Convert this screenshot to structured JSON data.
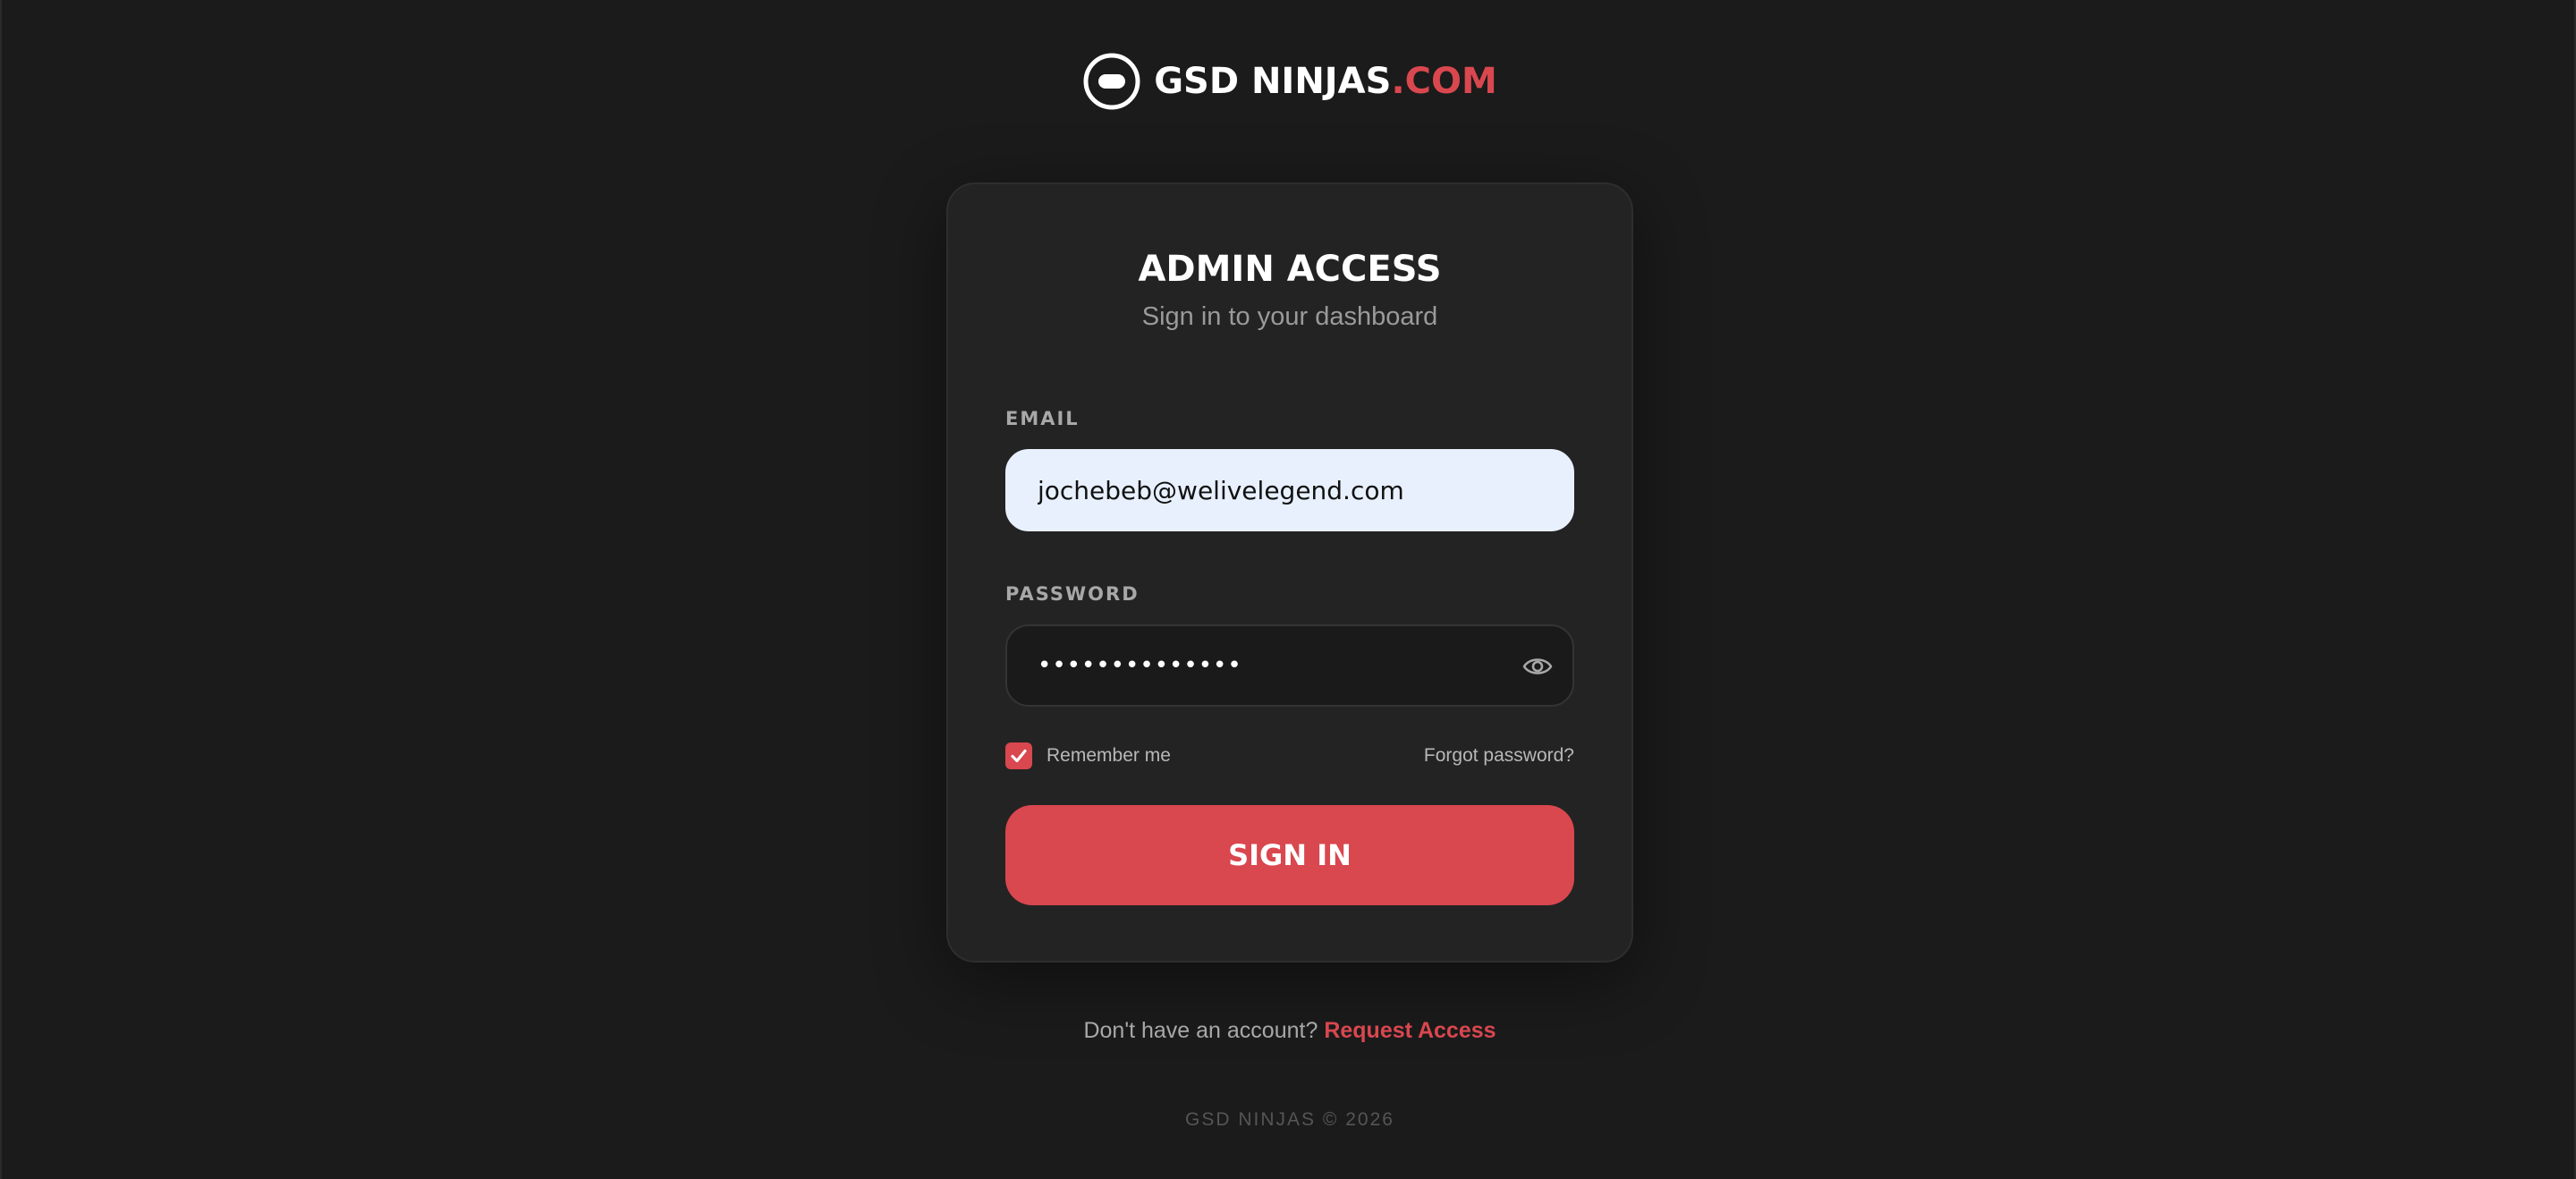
{
  "brand": {
    "name_main": "GSD NINJAS",
    "name_accent": ".COM",
    "logo_icon": "pill-circle-icon",
    "accent_color": "#d9474f"
  },
  "card": {
    "title": "ADMIN ACCESS",
    "subtitle": "Sign in to your dashboard"
  },
  "form": {
    "email_label": "EMAIL",
    "email_value": "jochebeb@welivelegend.com",
    "password_label": "PASSWORD",
    "password_masked": "••••••••••••••",
    "password_toggle_icon": "eye-icon",
    "remember_label": "Remember me",
    "remember_checked": true,
    "forgot_label": "Forgot password?",
    "submit_label": "SIGN IN"
  },
  "footer": {
    "prompt": "Don't have an account?",
    "link_label": "Request Access",
    "copyright": "GSD NINJAS © 2026"
  }
}
